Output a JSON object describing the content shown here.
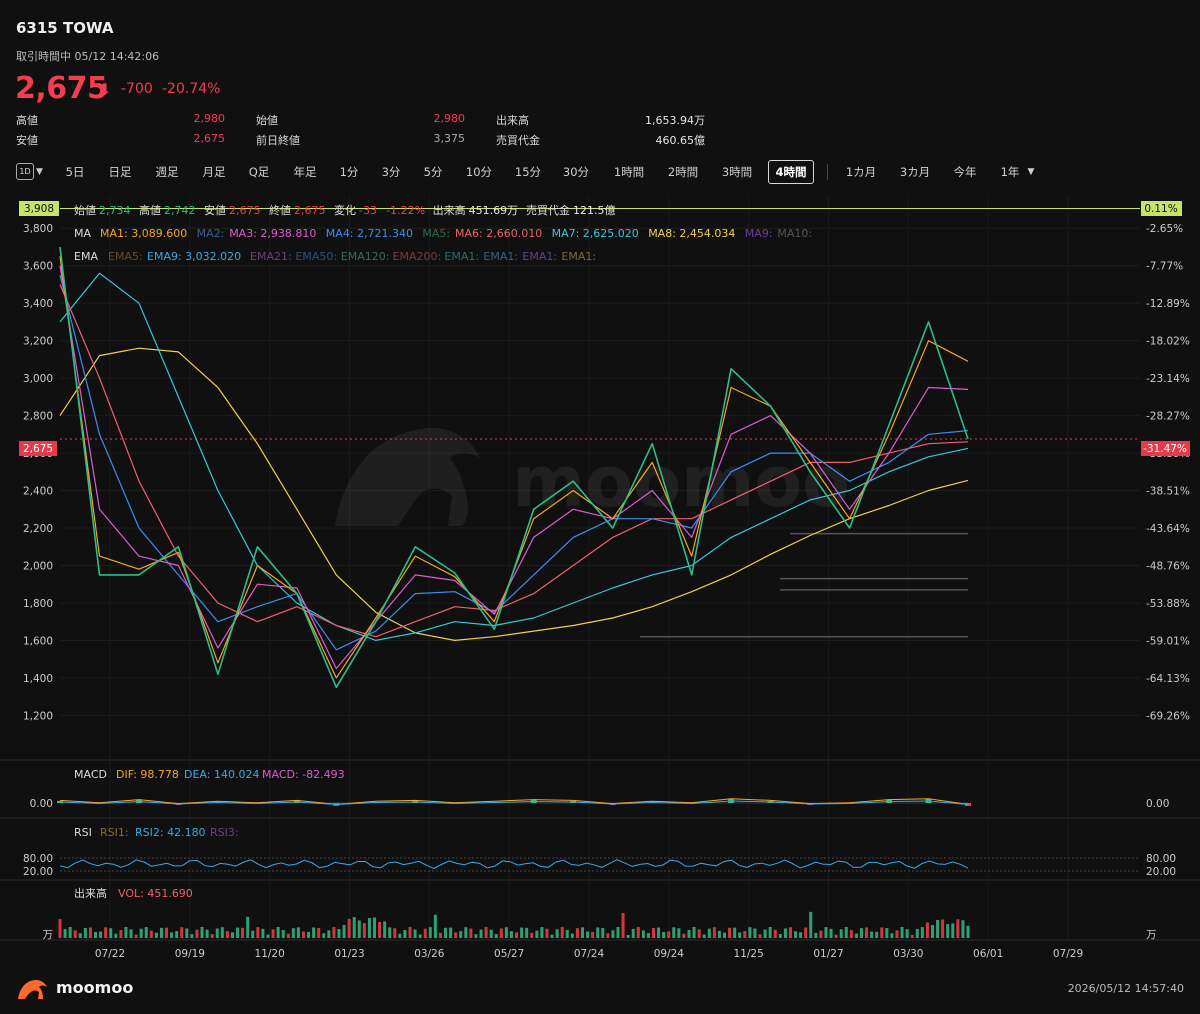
{
  "header": {
    "ticker": "6315  TOWA",
    "status": "取引時間中 05/12 14:42:06",
    "price": "2,675",
    "change": "-700",
    "change_pct": "-20.74%"
  },
  "stats": [
    {
      "label": "高値",
      "value": "2,980",
      "color": "red"
    },
    {
      "label": "始値",
      "value": "2,980",
      "color": "red"
    },
    {
      "label": "出来高",
      "value": "1,653.94万",
      "color": "white"
    },
    {
      "label": "安値",
      "value": "2,675",
      "color": "red"
    },
    {
      "label": "前日終値",
      "value": "3,375",
      "color": "grey"
    },
    {
      "label": "売買代金",
      "value": "460.65億",
      "color": "white"
    }
  ],
  "toolbar": {
    "interval_icon": "1D",
    "tabs": [
      "5日",
      "日足",
      "週足",
      "月足",
      "Q足",
      "年足",
      "1分",
      "3分",
      "5分",
      "10分",
      "15分",
      "30分",
      "1時間",
      "2時間",
      "3時間",
      "4時間"
    ],
    "active": "4時間",
    "ranges": [
      "1カ月",
      "3カ月",
      "今年",
      "1年"
    ]
  },
  "ohlc_row": {
    "items": [
      {
        "k": "始値",
        "v": "2,734",
        "vc": "#2ebd85"
      },
      {
        "k": "高値",
        "v": "2,742",
        "vc": "#2ebd85"
      },
      {
        "k": "安値",
        "v": "2,675",
        "vc": "#f43d4f"
      },
      {
        "k": "終値",
        "v": "2,675",
        "vc": "#f43d4f"
      },
      {
        "k": "変化",
        "v": "-33",
        "vc": "#f43d4f"
      },
      {
        "k": "",
        "v": "-1.22%",
        "vc": "#f43d4f"
      },
      {
        "k": "出来高",
        "v": "451.69万",
        "vc": "#e6e6e6"
      },
      {
        "k": "売買代金",
        "v": "121.5億",
        "vc": "#e6e6e6"
      }
    ]
  },
  "ma_row": {
    "label": "MA",
    "items": [
      {
        "t": "MA1: 3,089.600",
        "c": "#f5a623"
      },
      {
        "t": "MA2:",
        "c": "#3a5f8a"
      },
      {
        "t": "MA3: 2,938.810",
        "c": "#e05ad0"
      },
      {
        "t": "MA4: 2,721.340",
        "c": "#3b8ef0"
      },
      {
        "t": "MA5:",
        "c": "#2f6b4a"
      },
      {
        "t": "MA6: 2,660.010",
        "c": "#f06070"
      },
      {
        "t": "MA7: 2,625.020",
        "c": "#36c8d8"
      },
      {
        "t": "MA8: 2,454.034",
        "c": "#f0d050"
      },
      {
        "t": "MA9:",
        "c": "#6a3fa0"
      },
      {
        "t": "MA10:",
        "c": "#555"
      }
    ]
  },
  "ema_row": {
    "label": "EMA",
    "items": [
      {
        "t": "EMA5:",
        "c": "#6b4a2a"
      },
      {
        "t": "EMA9: 3,032.020",
        "c": "#3aa8e8"
      },
      {
        "t": "EMA21:",
        "c": "#6a3f7a"
      },
      {
        "t": "EMA50:",
        "c": "#2a4f7a"
      },
      {
        "t": "EMA120:",
        "c": "#3a6a5a"
      },
      {
        "t": "EMA200:",
        "c": "#7a3a3a"
      },
      {
        "t": "EMA1:",
        "c": "#2f6b6b"
      },
      {
        "t": "EMA1:",
        "c": "#3a5f8a"
      },
      {
        "t": "EMA1:",
        "c": "#6a3f8a"
      },
      {
        "t": "EMA1:",
        "c": "#7a6a3a"
      }
    ]
  },
  "watermark": "moomoo",
  "macd_row": {
    "label": "MACD",
    "dif": "DIF: 98.778",
    "dea": "DEA: 140.024",
    "macd": "MACD: -82.493"
  },
  "rsi_row": {
    "label": "RSI",
    "rsi1": "RSI1:",
    "rsi2": "RSI2: 42.180",
    "rsi3": "RSI3:"
  },
  "vol_row": {
    "label": "出来高",
    "vol": "VOL: 451.690"
  },
  "axis": {
    "price_ticks": [
      "3,800",
      "3,600",
      "3,400",
      "3,200",
      "3,000",
      "2,800",
      "2,600",
      "2,400",
      "2,200",
      "2,000",
      "1,800",
      "1,600",
      "1,400",
      "1,200"
    ],
    "pct_ticks": [
      "-2.65%",
      "-7.77%",
      "-12.89%",
      "-18.02%",
      "-23.14%",
      "-28.27%",
      "-33.39%",
      "-38.51%",
      "-43.64%",
      "-48.76%",
      "-53.88%",
      "-59.01%",
      "-64.13%",
      "-69.26%"
    ],
    "top_left_tag": "3,908",
    "top_right_tag": "0.11%",
    "last_left_tag": "2,675",
    "last_right_tag": "-31.47%",
    "macd_zero_left": "0.00",
    "macd_zero_right": "0.00",
    "rsi_left": [
      "80.00",
      "20.00"
    ],
    "rsi_right": [
      "80.00",
      "20.00"
    ],
    "vol_unit_left": "万",
    "vol_unit_right": "万",
    "dates": [
      "07/22",
      "09/19",
      "11/20",
      "01/23",
      "03/26",
      "05/27",
      "07/24",
      "09/24",
      "11/25",
      "01/27",
      "03/30",
      "06/01",
      "07/29"
    ]
  },
  "chart_data": {
    "type": "line",
    "title": "6315  TOWA",
    "ylim": [
      1090,
      3908
    ],
    "x": [
      "07/22",
      "09/19",
      "11/20",
      "01/23",
      "03/26",
      "05/27",
      "07/24",
      "09/24",
      "11/25",
      "01/27",
      "03/30",
      "06/01",
      "07/29"
    ],
    "series": [
      {
        "name": "Price",
        "color": "#2ebd85",
        "values": [
          3700,
          1950,
          1950,
          2100,
          1420,
          2100,
          1850,
          1350,
          1700,
          2100,
          1960,
          1660,
          2300,
          2450,
          2200,
          2650,
          1950,
          3050,
          2850,
          2500,
          2200,
          2750,
          3300,
          2675
        ]
      },
      {
        "name": "MA1: 3,089.600",
        "color": "#f5a623",
        "values": [
          3650,
          2050,
          1980,
          2070,
          1480,
          2000,
          1850,
          1400,
          1720,
          2050,
          1940,
          1700,
          2250,
          2400,
          2250,
          2550,
          2050,
          2950,
          2850,
          2550,
          2250,
          2700,
          3200,
          3090
        ]
      },
      {
        "name": "MA3: 2,938.810",
        "color": "#e05ad0",
        "values": [
          3600,
          2300,
          2050,
          2000,
          1560,
          1900,
          1880,
          1450,
          1700,
          1950,
          1920,
          1740,
          2150,
          2300,
          2250,
          2400,
          2150,
          2700,
          2800,
          2600,
          2300,
          2600,
          2950,
          2940
        ]
      },
      {
        "name": "MA4: 2,721.340",
        "color": "#3b8ef0",
        "values": [
          3550,
          2700,
          2200,
          1950,
          1700,
          1780,
          1850,
          1550,
          1650,
          1850,
          1860,
          1750,
          1950,
          2150,
          2250,
          2250,
          2200,
          2500,
          2600,
          2600,
          2450,
          2550,
          2700,
          2720
        ]
      },
      {
        "name": "MA6: 2,660.010",
        "color": "#f06070",
        "values": [
          3500,
          3000,
          2450,
          2050,
          1800,
          1700,
          1780,
          1680,
          1620,
          1700,
          1780,
          1760,
          1850,
          2000,
          2150,
          2250,
          2250,
          2350,
          2450,
          2550,
          2550,
          2600,
          2650,
          2660
        ]
      },
      {
        "name": "MA7: 2,625.020",
        "color": "#36c8d8",
        "values": [
          3300,
          3560,
          3400,
          2900,
          2400,
          2000,
          1800,
          1680,
          1600,
          1640,
          1700,
          1680,
          1720,
          1800,
          1880,
          1950,
          2000,
          2150,
          2250,
          2350,
          2400,
          2500,
          2580,
          2625
        ]
      },
      {
        "name": "MA8: 2,454.034",
        "color": "#f0d050",
        "values": [
          2800,
          3120,
          3160,
          3140,
          2950,
          2650,
          2300,
          1950,
          1750,
          1640,
          1600,
          1620,
          1650,
          1680,
          1720,
          1780,
          1860,
          1950,
          2060,
          2160,
          2250,
          2320,
          2400,
          2454
        ]
      }
    ],
    "macd": {
      "dif": 98.778,
      "dea": 140.024,
      "macd": -82.493
    },
    "rsi2": 42.18,
    "volume_last": 451.69,
    "legend_position": "top-left",
    "grid": true
  },
  "footer": {
    "brand": "moomoo",
    "timestamp": "2026/05/12 14:57:40"
  }
}
